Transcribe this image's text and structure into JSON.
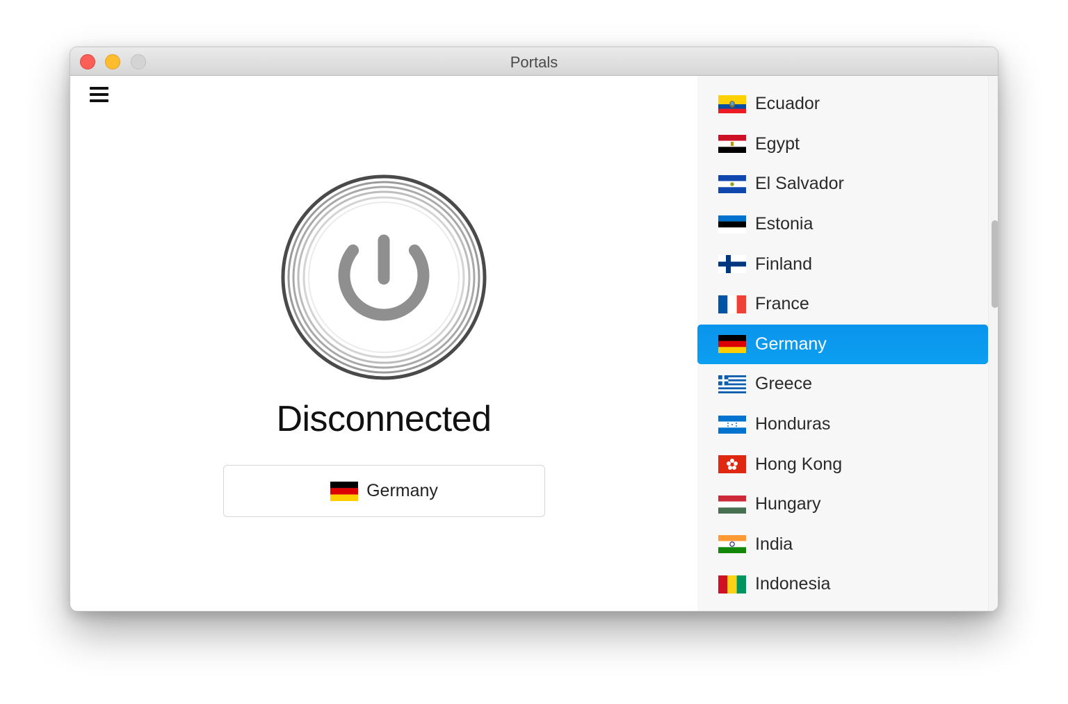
{
  "window": {
    "title": "Portals"
  },
  "main": {
    "status": "Disconnected",
    "selected_location": "Germany"
  },
  "countries": [
    {
      "name": "Ecuador",
      "flag": "ecuador-flag"
    },
    {
      "name": "Egypt",
      "flag": "egypt-flag"
    },
    {
      "name": "El Salvador",
      "flag": "el-salvador-flag"
    },
    {
      "name": "Estonia",
      "flag": "estonia-flag"
    },
    {
      "name": "Finland",
      "flag": "finland-flag"
    },
    {
      "name": "France",
      "flag": "france-flag"
    },
    {
      "name": "Germany",
      "flag": "germany-flag",
      "selected": true
    },
    {
      "name": "Greece",
      "flag": "greece-flag"
    },
    {
      "name": "Honduras",
      "flag": "honduras-flag"
    },
    {
      "name": "Hong Kong",
      "flag": "hong-kong-flag"
    },
    {
      "name": "Hungary",
      "flag": "hungary-flag"
    },
    {
      "name": "India",
      "flag": "india-flag"
    },
    {
      "name": "Indonesia",
      "flag": "indonesia-flag"
    }
  ],
  "colors": {
    "selection": "#0a94ec",
    "power_icon": "#8f8f8f",
    "close": "#fd5f57",
    "minimize": "#febc2e",
    "zoom_disabled": "#d4d4d4"
  }
}
